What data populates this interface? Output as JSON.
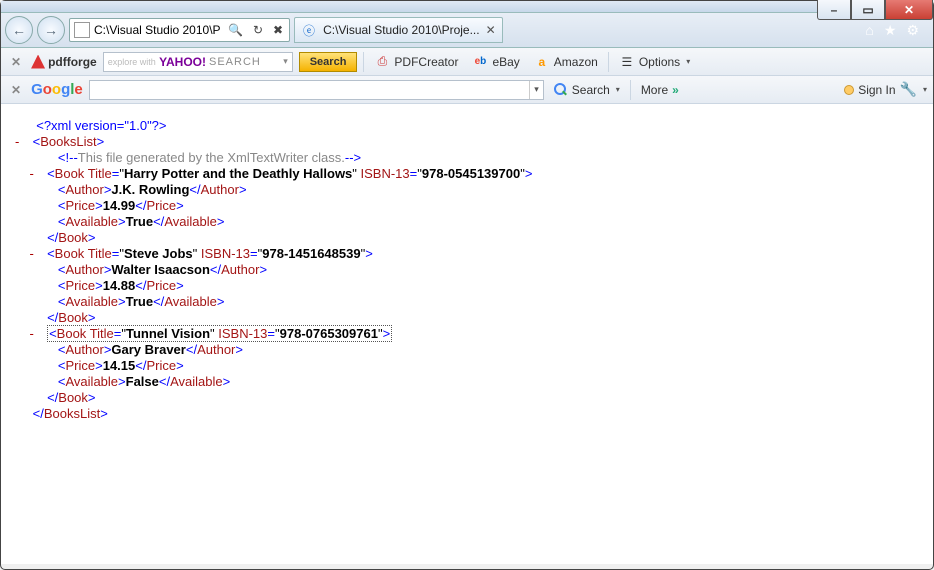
{
  "window": {
    "min": "–",
    "max": "▭",
    "close": "✕"
  },
  "nav": {
    "address": "C:\\Visual Studio 2010\\P",
    "address_suffix_icons": "🔍  ▾  ✖",
    "active_tab": "C:\\Visual Studio 2010\\Proje...",
    "tab_close": "✕",
    "ie_home": "⌂",
    "ie_star": "★",
    "ie_gear": "⚙"
  },
  "toolbar1": {
    "close": "✕",
    "pdfforge": "pdfforge",
    "yahoo_pre": "explore with",
    "yahoo_word": "YAHOO!",
    "yahoo_search": "SEARCH",
    "search_btn": "Search",
    "pdfcreator": "PDFCreator",
    "ebay": "eBay",
    "amazon": "Amazon",
    "options": "Options"
  },
  "toolbar2": {
    "close": "✕",
    "search": "Search",
    "more": "More",
    "more_sym": "»",
    "signin": "Sign In"
  },
  "xml": {
    "decl": "<?xml version=\"1.0\"?>",
    "root_open": "BooksList",
    "comment": "This file generated by the XmlTextWriter class.",
    "books": [
      {
        "title": "Harry Potter and the Deathly Hallows",
        "isbn": "978-0545139700",
        "author": "J.K. Rowling",
        "price": "14.99",
        "available": "True",
        "selected": false
      },
      {
        "title": "Steve Jobs",
        "isbn": "978-1451648539",
        "author": "Walter Isaacson",
        "price": "14.88",
        "available": "True",
        "selected": false
      },
      {
        "title": "Tunnel Vision",
        "isbn": "978-0765309761",
        "author": "Gary Braver",
        "price": "14.15",
        "available": "False",
        "selected": true
      }
    ],
    "root_close": "BooksList"
  }
}
